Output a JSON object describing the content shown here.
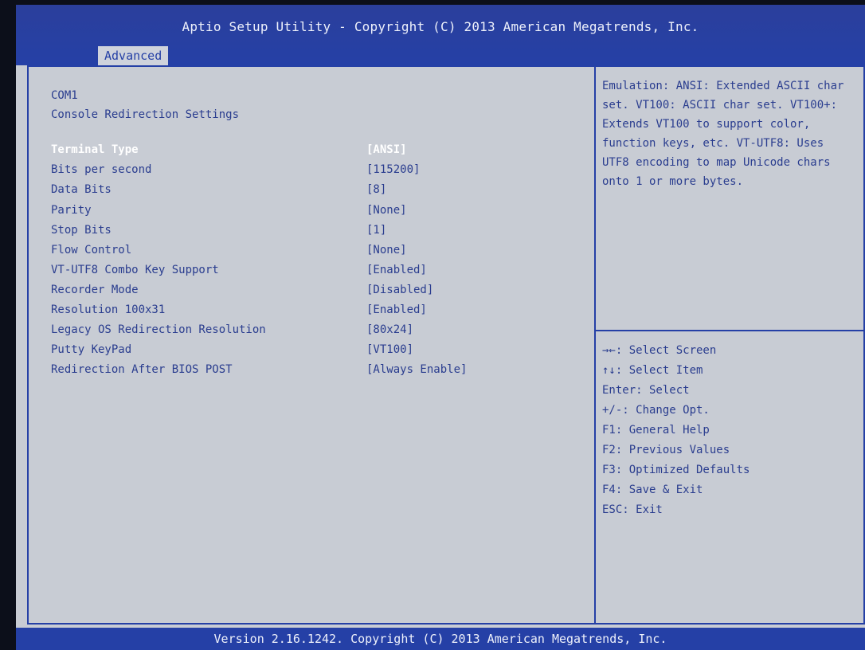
{
  "header": {
    "title": "Aptio Setup Utility - Copyright (C) 2013 American Megatrends, Inc.",
    "tab": "Advanced"
  },
  "main": {
    "section_title": "COM1",
    "section_subtitle": "Console Redirection Settings",
    "settings": [
      {
        "label": "Terminal Type",
        "value": "[ANSI]",
        "selected": true
      },
      {
        "label": "Bits per second",
        "value": "[115200]"
      },
      {
        "label": "Data Bits",
        "value": "[8]"
      },
      {
        "label": "Parity",
        "value": "[None]"
      },
      {
        "label": "Stop Bits",
        "value": "[1]"
      },
      {
        "label": "Flow Control",
        "value": "[None]"
      },
      {
        "label": "VT-UTF8 Combo Key Support",
        "value": "[Enabled]"
      },
      {
        "label": "Recorder Mode",
        "value": "[Disabled]"
      },
      {
        "label": "Resolution 100x31",
        "value": "[Enabled]"
      },
      {
        "label": "Legacy OS Redirection Resolution",
        "value": "[80x24]"
      },
      {
        "label": "Putty KeyPad",
        "value": "[VT100]"
      },
      {
        "label": "Redirection After BIOS POST",
        "value": "[Always Enable]"
      }
    ]
  },
  "help": {
    "text": "Emulation: ANSI: Extended ASCII char set. VT100: ASCII char set. VT100+: Extends VT100 to support color, function keys, etc. VT-UTF8: Uses UTF8 encoding to map Unicode chars onto 1 or more bytes."
  },
  "keys": [
    "→←: Select Screen",
    "↑↓: Select Item",
    "Enter: Select",
    "+/-: Change Opt.",
    "F1: General Help",
    "F2: Previous Values",
    "F3: Optimized Defaults",
    "F4: Save & Exit",
    "ESC: Exit"
  ],
  "footer": {
    "text": "Version 2.16.1242. Copyright (C) 2013 American Megatrends, Inc."
  }
}
